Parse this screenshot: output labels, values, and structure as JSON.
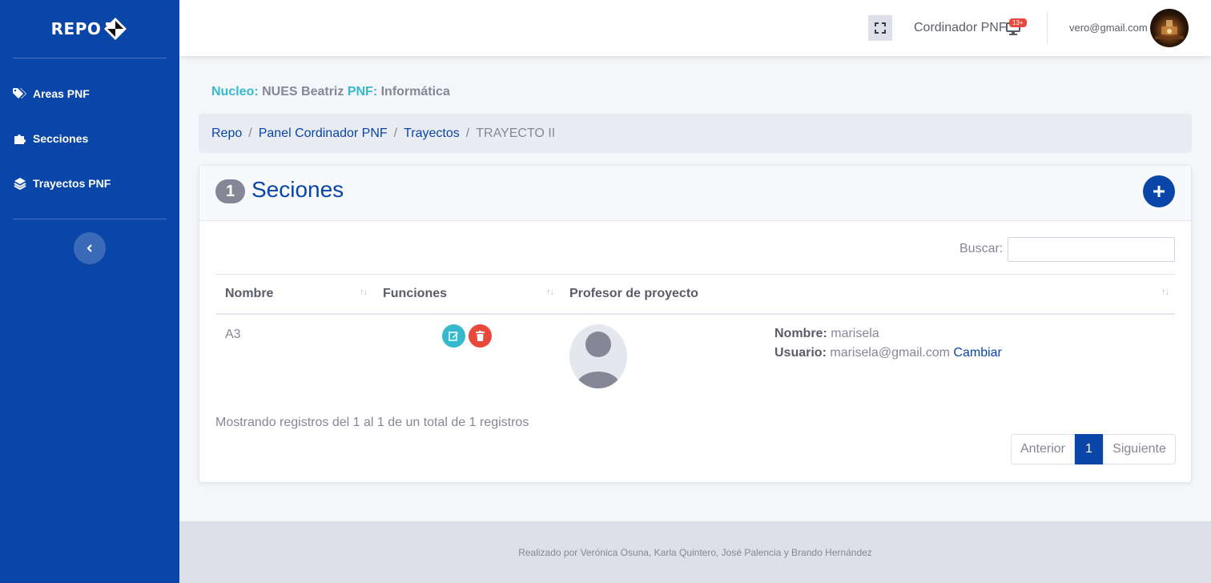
{
  "brand": {
    "name": "REPO"
  },
  "sidebar": {
    "items": [
      {
        "label": "Areas PNF",
        "icon": "tags-icon"
      },
      {
        "label": "Secciones",
        "icon": "puzzle-icon"
      },
      {
        "label": "Trayectos PNF",
        "icon": "layers-icon"
      }
    ],
    "toggle_icon": "chevron-left-icon"
  },
  "topbar": {
    "role": "Cordinador PNF",
    "notification_badge": "13+",
    "email": "vero@gmail.com"
  },
  "context": {
    "nucleo_label": "Nucleo:",
    "nucleo_value": "NUES Beatriz",
    "pnf_label": "PNF:",
    "pnf_value": "Informática"
  },
  "breadcrumb": {
    "items": [
      "Repo",
      "Panel Cordinador PNF",
      "Trayectos"
    ],
    "active": "TRAYECTO II",
    "separator": "/"
  },
  "card": {
    "count": "1",
    "title": "Seciones"
  },
  "search": {
    "label": "Buscar:",
    "value": ""
  },
  "table": {
    "headers": [
      "Nombre",
      "Funciones",
      "Profesor de proyecto"
    ],
    "sort_glyph": "↑↓",
    "rows": [
      {
        "nombre": "A3",
        "prof_nombre_label": "Nombre:",
        "prof_nombre": "marisela",
        "prof_usuario_label": "Usuario:",
        "prof_usuario": "marisela@gmail.com",
        "change_label": "Cambiar"
      }
    ]
  },
  "showing": "Mostrando registros del 1 al 1 de un total de 1 registros",
  "pagination": {
    "prev": "Anterior",
    "current": "1",
    "next": "Siguiente"
  },
  "footer": "Realizado por Verónica Osuna, Karla Quintero, José Palencia y Brando Hernández",
  "colors": {
    "primary": "#0a45a8",
    "teal": "#36b9cc",
    "danger": "#e74a3b"
  }
}
